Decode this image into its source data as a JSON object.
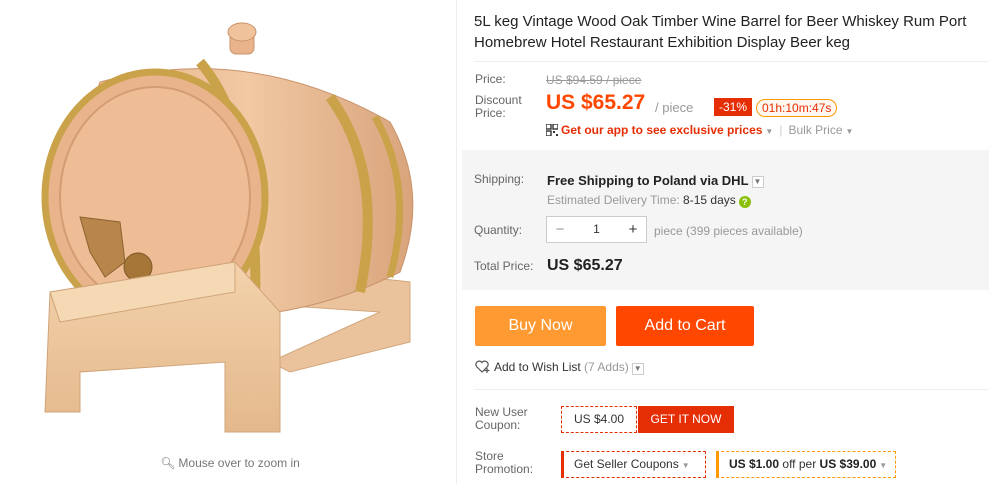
{
  "image": {
    "zoom_hint": "Mouse over to zoom in"
  },
  "product": {
    "title": "5L keg Vintage Wood Oak Timber Wine Barrel for Beer Whiskey Rum Port Homebrew Hotel Restaurant Exhibition Display Beer keg"
  },
  "price": {
    "price_label": "Price:",
    "original_price": "US $94.59 / piece",
    "discount_label": "Discount Price:",
    "sale_price": "US $65.27",
    "per_piece": "/ piece",
    "discount_badge": "-31%",
    "countdown": "01h:10m:47s",
    "app_prices": "Get our app to see exclusive prices",
    "bulk_price": "Bulk Price"
  },
  "shipping": {
    "label": "Shipping:",
    "value": "Free Shipping to Poland via DHL",
    "delivery_label": "Estimated Delivery Time:",
    "delivery_days": "8-15 days"
  },
  "quantity": {
    "label": "Quantity:",
    "value": "1",
    "minus": "−",
    "plus": "+",
    "available": "piece (399 pieces available)"
  },
  "total": {
    "label": "Total Price:",
    "value": "US $65.27"
  },
  "actions": {
    "buy_now": "Buy Now",
    "add_to_cart": "Add to Cart",
    "wish_list": "Add to Wish List",
    "wish_count": "(7 Adds)"
  },
  "coupons": {
    "new_user_label": "New User Coupon:",
    "coupon_amount": "US $4.00",
    "get_it_now": "GET IT NOW",
    "store_label": "Store Promotion:",
    "seller_coupons": "Get Seller Coupons",
    "offer_amount": "US $1.00",
    "offer_mid": "off per",
    "offer_threshold": "US $39.00"
  },
  "colors": {
    "accent": "#ff4700",
    "buy_now": "#ff9a33",
    "badge": "#e62e04"
  }
}
